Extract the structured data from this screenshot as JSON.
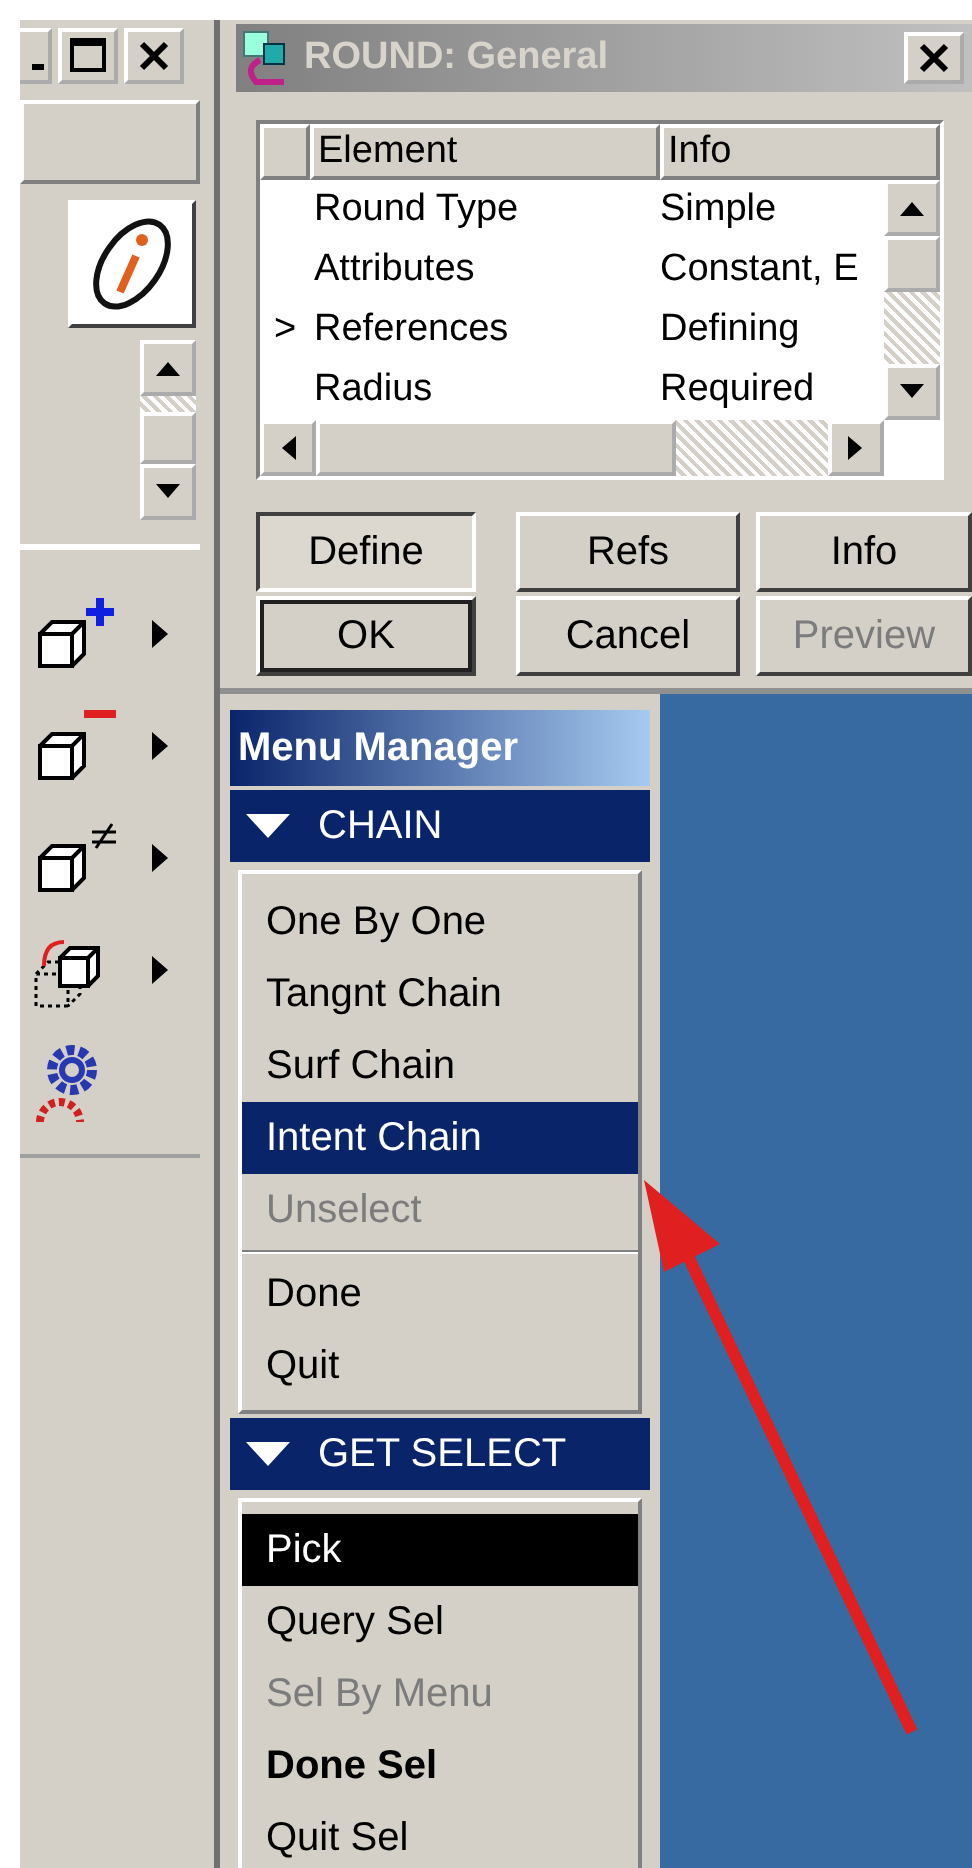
{
  "dialog": {
    "title": "ROUND: General",
    "table": {
      "columns": [
        "Element",
        "Info"
      ],
      "rows": [
        {
          "element": "Round Type",
          "info": "Simple"
        },
        {
          "element": "Attributes",
          "info": "Constant, E"
        },
        {
          "marker": ">",
          "element": "References",
          "info": "Defining"
        },
        {
          "element": "Radius",
          "info": "Required"
        }
      ]
    },
    "buttons": [
      {
        "label": "Define",
        "pressed": true,
        "default": false,
        "disabled": false
      },
      {
        "label": "Refs",
        "pressed": false,
        "default": false,
        "disabled": false
      },
      {
        "label": "Info",
        "pressed": false,
        "default": false,
        "disabled": false
      },
      {
        "label": "OK",
        "pressed": false,
        "default": true,
        "disabled": false
      },
      {
        "label": "Cancel",
        "pressed": false,
        "default": false,
        "disabled": false
      },
      {
        "label": "Preview",
        "pressed": false,
        "default": false,
        "disabled": true
      }
    ]
  },
  "menu_manager": {
    "title": "Menu Manager",
    "sections": [
      {
        "title": "CHAIN",
        "expanded": true,
        "groups": [
          [
            {
              "label": "One By One",
              "selected": false,
              "focused": false,
              "disabled": false,
              "default": false
            },
            {
              "label": "Tangnt Chain",
              "selected": false,
              "focused": false,
              "disabled": false,
              "default": false
            },
            {
              "label": "Surf Chain",
              "selected": false,
              "focused": false,
              "disabled": false,
              "default": false
            },
            {
              "label": "Intent Chain",
              "selected": true,
              "focused": false,
              "disabled": false,
              "default": false
            },
            {
              "label": "Unselect",
              "selected": false,
              "focused": false,
              "disabled": true,
              "default": false
            }
          ],
          [
            {
              "label": "Done",
              "selected": false,
              "focused": false,
              "disabled": false,
              "default": false
            },
            {
              "label": "Quit",
              "selected": false,
              "focused": false,
              "disabled": false,
              "default": false
            }
          ]
        ]
      },
      {
        "title": "GET SELECT",
        "expanded": true,
        "groups": [
          [
            {
              "label": "Pick",
              "selected": false,
              "focused": true,
              "disabled": false,
              "default": false
            },
            {
              "label": "Query Sel",
              "selected": false,
              "focused": false,
              "disabled": false,
              "default": false
            },
            {
              "label": "Sel By Menu",
              "selected": false,
              "focused": false,
              "disabled": true,
              "default": false
            },
            {
              "label": "Done Sel",
              "selected": false,
              "focused": false,
              "disabled": false,
              "default": true
            },
            {
              "label": "Quit Sel",
              "selected": false,
              "focused": false,
              "disabled": false,
              "default": false
            }
          ]
        ]
      }
    ]
  }
}
